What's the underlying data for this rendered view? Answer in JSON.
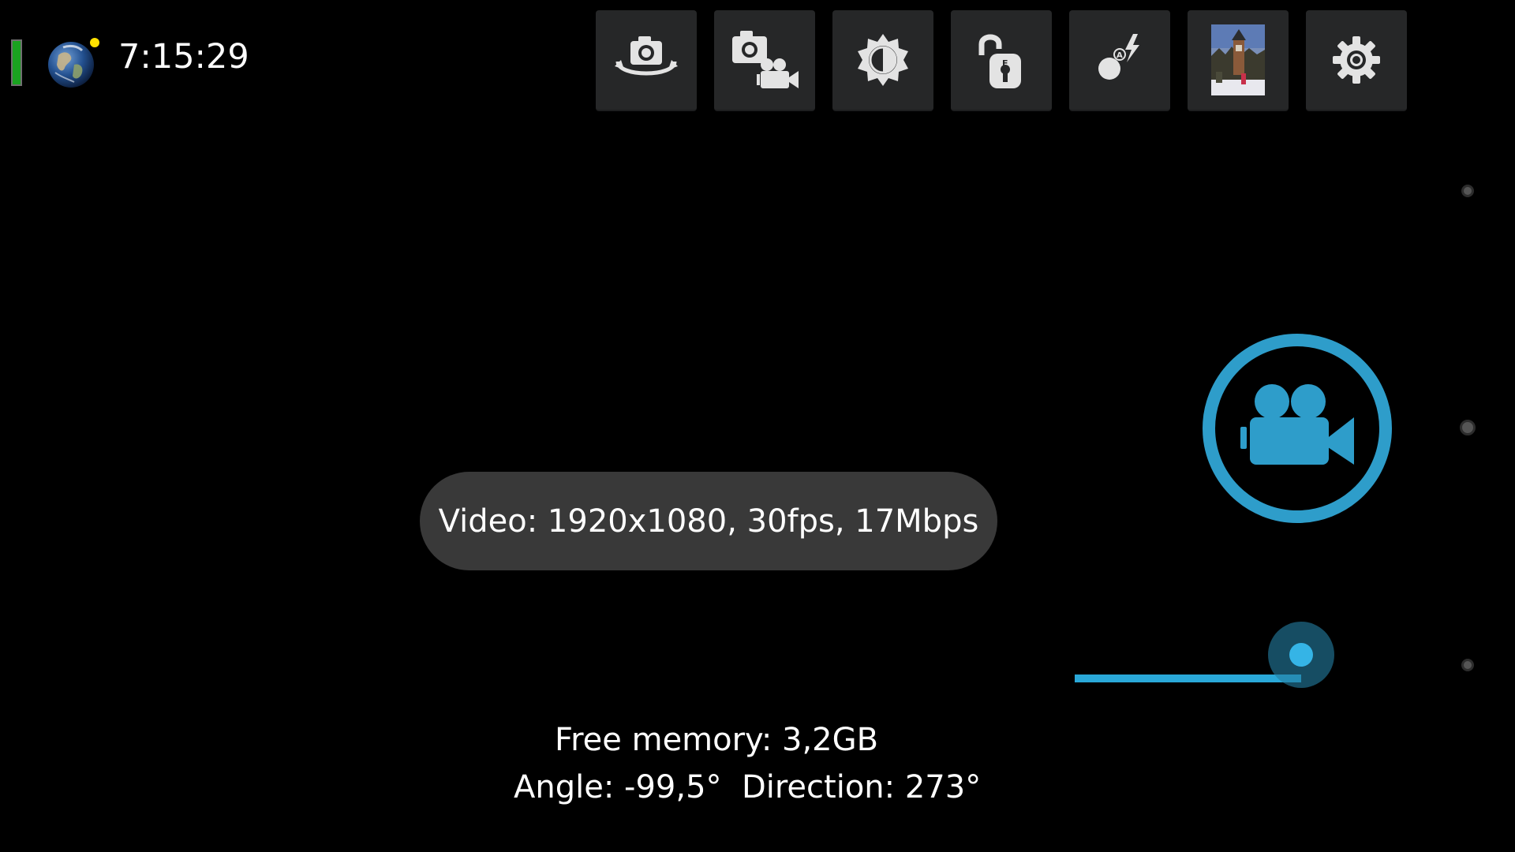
{
  "status": {
    "clock": "7:15:29",
    "battery_color": "#1aa320",
    "gps_dot_color": "#ffe100",
    "globe_icon": "earth-globe-icon"
  },
  "toolbar": {
    "buttons": [
      {
        "name": "switch-camera",
        "icon": "camera-rotate-icon"
      },
      {
        "name": "photo-video-mode",
        "icon": "camera-video-mode-icon"
      },
      {
        "name": "exposure",
        "icon": "exposure-sun-icon"
      },
      {
        "name": "exposure-lock",
        "icon": "unlock-e-icon"
      },
      {
        "name": "flash",
        "icon": "auto-flash-icon"
      },
      {
        "name": "gallery",
        "icon": "gallery-thumbnail"
      },
      {
        "name": "settings",
        "icon": "gear-icon"
      }
    ]
  },
  "toast": {
    "text": "Video: 1920x1080, 30fps, 17Mbps"
  },
  "record": {
    "icon": "video-camera-icon",
    "accent": "#2e9dca"
  },
  "zoom_slider": {
    "value": 0.7
  },
  "info": {
    "free_memory": "Free memory: 3,2GB",
    "angle_direction": "Angle: -99,5°  Direction: 273°"
  }
}
